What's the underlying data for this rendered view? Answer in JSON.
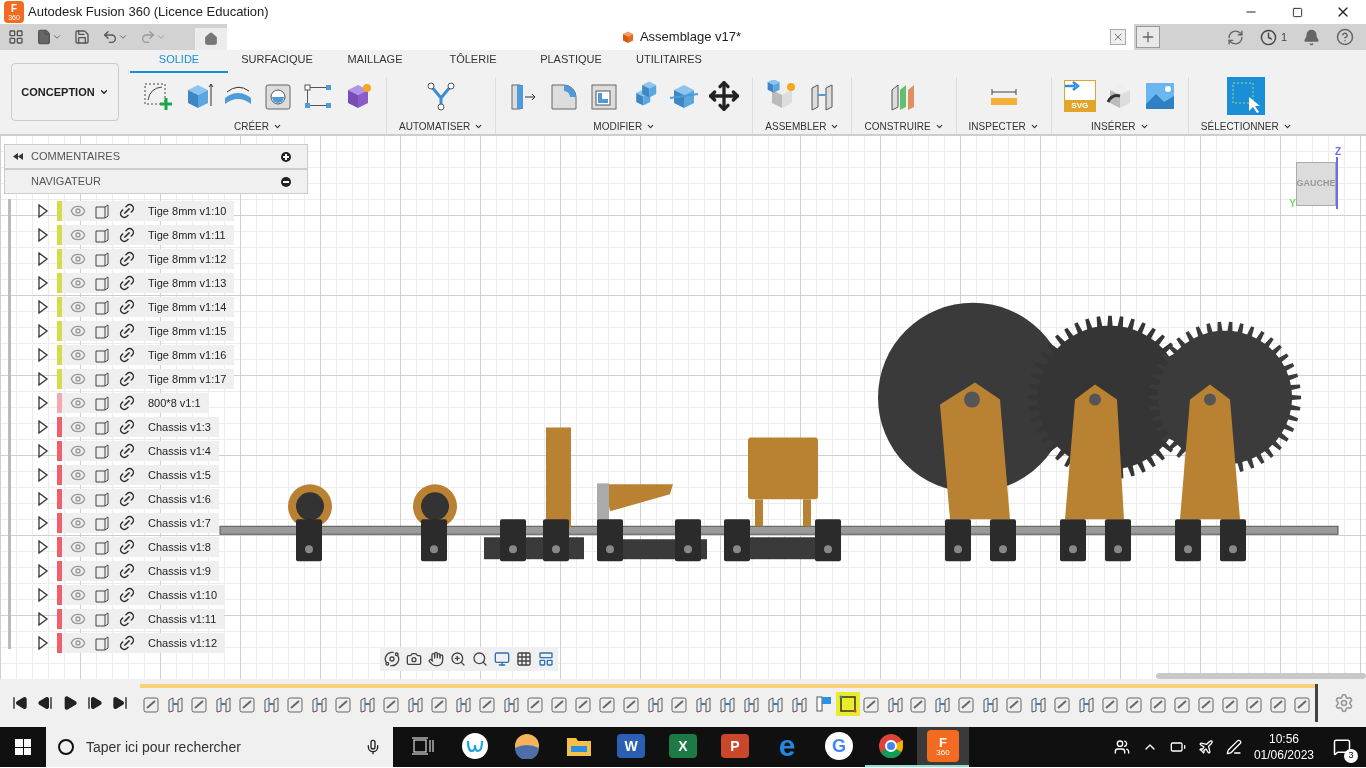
{
  "window": {
    "title": "Autodesk Fusion 360 (Licence Education)",
    "logo": {
      "letter": "F",
      "sub": "360"
    }
  },
  "document_tab": {
    "title": "Assemblage v17*"
  },
  "header_right": {
    "job_count": "1"
  },
  "workspace_button": {
    "label": "CONCEPTION"
  },
  "tabs": [
    {
      "label": "SOLIDE",
      "selected": true
    },
    {
      "label": "SURFACIQUE",
      "selected": false
    },
    {
      "label": "MAILLAGE",
      "selected": false
    },
    {
      "label": "TÔLERIE",
      "selected": false
    },
    {
      "label": "PLASTIQUE",
      "selected": false
    },
    {
      "label": "UTILITAIRES",
      "selected": false
    }
  ],
  "tool_groups": [
    {
      "label": "CRÉER",
      "tools": [
        {
          "kind": "sketch"
        },
        {
          "kind": "extrude"
        },
        {
          "kind": "revolve"
        },
        {
          "kind": "hole"
        },
        {
          "kind": "pattern"
        },
        {
          "kind": "form"
        }
      ]
    },
    {
      "label": "AUTOMATISER",
      "tools": [
        {
          "kind": "automate"
        }
      ]
    },
    {
      "label": "MODIFIER",
      "tools": [
        {
          "kind": "presspull"
        },
        {
          "kind": "fillet"
        },
        {
          "kind": "shell"
        },
        {
          "kind": "combine"
        },
        {
          "kind": "offset"
        },
        {
          "kind": "move"
        }
      ]
    },
    {
      "label": "ASSEMBLER",
      "tools": [
        {
          "kind": "component"
        },
        {
          "kind": "joint"
        }
      ]
    },
    {
      "label": "CONSTRUIRE",
      "tools": [
        {
          "kind": "plane"
        }
      ]
    },
    {
      "label": "INSPECTER",
      "tools": [
        {
          "kind": "measure"
        }
      ]
    },
    {
      "label": "INSÉRER",
      "tools": [
        {
          "kind": "svg",
          "text": "SVG"
        },
        {
          "kind": "insert"
        },
        {
          "kind": "image"
        }
      ]
    },
    {
      "label": "SÉLECTIONNER",
      "tools": [
        {
          "kind": "select"
        }
      ]
    }
  ],
  "panels": [
    {
      "title": "COMMENTAIRES",
      "expanded": false
    },
    {
      "title": "NAVIGATEUR",
      "expanded": true
    }
  ],
  "browser": {
    "items": [
      {
        "name": "Tige 8mm v1:10",
        "color": "#d4dc4a"
      },
      {
        "name": "Tige 8mm v1:11",
        "color": "#d4dc4a"
      },
      {
        "name": "Tige 8mm v1:12",
        "color": "#d4dc4a"
      },
      {
        "name": "Tige 8mm v1:13",
        "color": "#d4dc4a"
      },
      {
        "name": "Tige 8mm v1:14",
        "color": "#d4dc4a"
      },
      {
        "name": "Tige 8mm v1:15",
        "color": "#d4dc4a"
      },
      {
        "name": "Tige 8mm v1:16",
        "color": "#d4dc4a"
      },
      {
        "name": "Tige 8mm v1:17",
        "color": "#d4dc4a"
      },
      {
        "name": "800*8 v1:1",
        "color": "#f5a9ae"
      },
      {
        "name": "Chassis v1:3",
        "color": "#f0606b"
      },
      {
        "name": "Chassis v1:4",
        "color": "#f0606b"
      },
      {
        "name": "Chassis v1:5",
        "color": "#f0606b"
      },
      {
        "name": "Chassis v1:6",
        "color": "#f0606b"
      },
      {
        "name": "Chassis v1:7",
        "color": "#f0606b"
      },
      {
        "name": "Chassis v1:8",
        "color": "#f0606b"
      },
      {
        "name": "Chassis v1:9",
        "color": "#f0606b"
      },
      {
        "name": "Chassis v1:10",
        "color": "#f0606b"
      },
      {
        "name": "Chassis v1:11",
        "color": "#f0606b"
      },
      {
        "name": "Chassis v1:12",
        "color": "#f0606b"
      }
    ]
  },
  "view_cube": {
    "face": "GAUCHE",
    "axis_z": "Z",
    "axis_y": "Y"
  },
  "timeline": {
    "items": [
      {
        "kind": "link",
        "selected": false
      },
      {
        "kind": "rigid",
        "selected": false
      },
      {
        "kind": "link",
        "selected": false
      },
      {
        "kind": "rigid",
        "selected": false
      },
      {
        "kind": "link",
        "selected": false
      },
      {
        "kind": "rigid",
        "selected": false
      },
      {
        "kind": "link",
        "selected": false
      },
      {
        "kind": "rigid",
        "selected": false
      },
      {
        "kind": "link",
        "selected": false
      },
      {
        "kind": "rigid",
        "selected": false
      },
      {
        "kind": "link",
        "selected": false
      },
      {
        "kind": "rigid",
        "selected": false
      },
      {
        "kind": "link",
        "selected": false
      },
      {
        "kind": "rigid",
        "selected": false
      },
      {
        "kind": "link",
        "selected": false
      },
      {
        "kind": "rigid",
        "selected": false
      },
      {
        "kind": "link",
        "selected": false
      },
      {
        "kind": "link",
        "selected": false
      },
      {
        "kind": "link",
        "selected": false
      },
      {
        "kind": "link",
        "selected": false
      },
      {
        "kind": "link",
        "selected": false
      },
      {
        "kind": "rigid",
        "selected": false
      },
      {
        "kind": "link",
        "selected": false
      },
      {
        "kind": "rigid",
        "selected": false
      },
      {
        "kind": "rigid",
        "selected": false
      },
      {
        "kind": "rigid",
        "selected": false
      },
      {
        "kind": "rigid",
        "selected": false
      },
      {
        "kind": "rigid",
        "selected": false
      },
      {
        "kind": "flag",
        "selected": false
      },
      {
        "kind": "sketch",
        "selected": true
      },
      {
        "kind": "link",
        "selected": false
      },
      {
        "kind": "rigid",
        "selected": false
      },
      {
        "kind": "link",
        "selected": false
      },
      {
        "kind": "rigid",
        "selected": false
      },
      {
        "kind": "link",
        "selected": false
      },
      {
        "kind": "rigid",
        "selected": false
      },
      {
        "kind": "link",
        "selected": false
      },
      {
        "kind": "rigid",
        "selected": false
      },
      {
        "kind": "link",
        "selected": false
      },
      {
        "kind": "rigid",
        "selected": false
      },
      {
        "kind": "link",
        "selected": false
      },
      {
        "kind": "link",
        "selected": false
      },
      {
        "kind": "link",
        "selected": false
      },
      {
        "kind": "link",
        "selected": false
      },
      {
        "kind": "link",
        "selected": false
      },
      {
        "kind": "link",
        "selected": false
      },
      {
        "kind": "link",
        "selected": false
      },
      {
        "kind": "link",
        "selected": false
      },
      {
        "kind": "link",
        "selected": false
      }
    ]
  },
  "taskbar": {
    "search_placeholder": "Taper ici pour rechercher",
    "apps": [
      {
        "kind": "taskview",
        "open": false,
        "selected": false
      },
      {
        "kind": "w-app",
        "open": false,
        "selected": false
      },
      {
        "kind": "sunset-app",
        "open": false,
        "selected": false
      },
      {
        "kind": "folder",
        "open": false,
        "selected": false
      },
      {
        "kind": "word",
        "letter": "W",
        "open": false,
        "selected": false
      },
      {
        "kind": "excel",
        "letter": "X",
        "open": false,
        "selected": false
      },
      {
        "kind": "powerpoint",
        "letter": "P",
        "open": false,
        "selected": false
      },
      {
        "kind": "edge",
        "letter": "e",
        "open": false,
        "selected": false
      },
      {
        "kind": "google",
        "letter": "G",
        "open": false,
        "selected": false
      },
      {
        "kind": "chrome",
        "open": true,
        "selected": false
      },
      {
        "kind": "fusion",
        "letter": "F",
        "sub": "360",
        "open": true,
        "selected": true
      }
    ],
    "time": "10:56",
    "date": "01/06/2023",
    "notifications": "3"
  }
}
